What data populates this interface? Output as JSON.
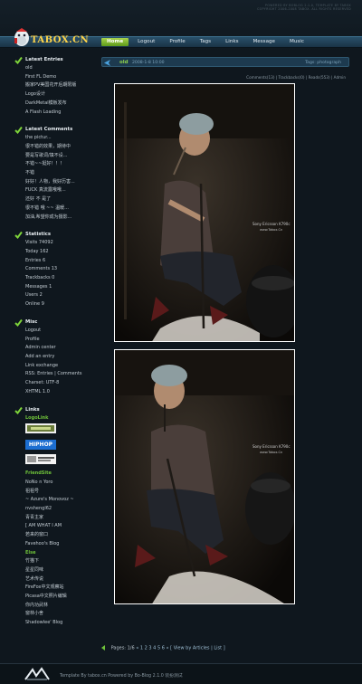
{
  "site": {
    "name": "TABOX.CN",
    "top_note_1": "POWERED BY BOBLOG 2.1.0, TEMPLATE BY TABOX",
    "top_note_2": "COPYRIGHT 2006-2008 TABOX. ALL RIGHTS RESERVED"
  },
  "nav": {
    "items": [
      "Home",
      "Logout",
      "Profile",
      "Tags",
      "Links",
      "Message",
      "Music"
    ],
    "active": "Home"
  },
  "sidebar": {
    "latest_entries": {
      "title": "Latest Entries",
      "items": [
        "old",
        "First FL Demo",
        "搬家PV美国花开后期限版",
        "Logo设计",
        "DarkMetal模板发布",
        "A Flash Loading"
      ]
    },
    "latest_comments": {
      "title": "Latest Comments",
      "items": [
        "the pictur...",
        "很不错的效果，期待中",
        "要是写歌词/填不设...",
        "不错~~挺好！！！",
        "不错",
        "好好！人物，我好历害...",
        "FUCK 真流露哦哦...",
        "还好 不 是了",
        "很不错 哦 ~~ 温暖...",
        "加油,希望你成为摄影..."
      ]
    },
    "statistics": {
      "title": "Statistics",
      "items": [
        "Visits 74092",
        "Today 162",
        "Entries 6",
        "Comments 13",
        "Trackbacks 0",
        "Messages 1",
        "Users 2",
        "Online 9"
      ]
    },
    "misc": {
      "title": "Misc",
      "items": [
        "Logout",
        "Profile",
        "Admin center",
        "Add an entry",
        "Link exchange",
        "RSS: Entries | Comments",
        "Charset: UTF-8",
        "XHTML 1.0"
      ]
    },
    "links": {
      "title": "Links",
      "logo_link_title": "LogoLink",
      "banner_label": "HIPHOP",
      "friend_title": "FriendSite",
      "friends": [
        "NoNo n Yoro",
        "祖祖号",
        "~ Azure's Monovoz ~",
        "nvshengl62",
        "青青主家",
        "[ AM WHAT I AM",
        "若来的窗口",
        "Favehoo's Blog"
      ],
      "else_title": "Else",
      "else_items": [
        "竹猫下",
        "星星同味",
        "艺术传说",
        "FireFox中文观察站",
        "Picasa中文照片编辑",
        "你内功武林",
        "窗林小舍",
        "Shadowlee' Blog"
      ]
    }
  },
  "post": {
    "title": "old",
    "date": "2008-1-8 10:00",
    "tags": "Tags: photograph",
    "meta": "Comments(13) | Trackbacks(0) | Reads(553) | Admin",
    "watermark": "Sony Ericsson K790c",
    "watermark_sub": "www.Tabox.Cn"
  },
  "pager": {
    "text": "Pages: 1/6",
    "pages": "« 1 2 3 4 5 6 »",
    "view": "[ View by Articles | List ]"
  },
  "footer": {
    "text": "Template By tabox.cn Powered by Bo-Blog 2.1.0 装扮测试"
  },
  "colors": {
    "accent": "#8fd14f",
    "logo": "#ffd54a",
    "nav": "#1d3a4f"
  }
}
